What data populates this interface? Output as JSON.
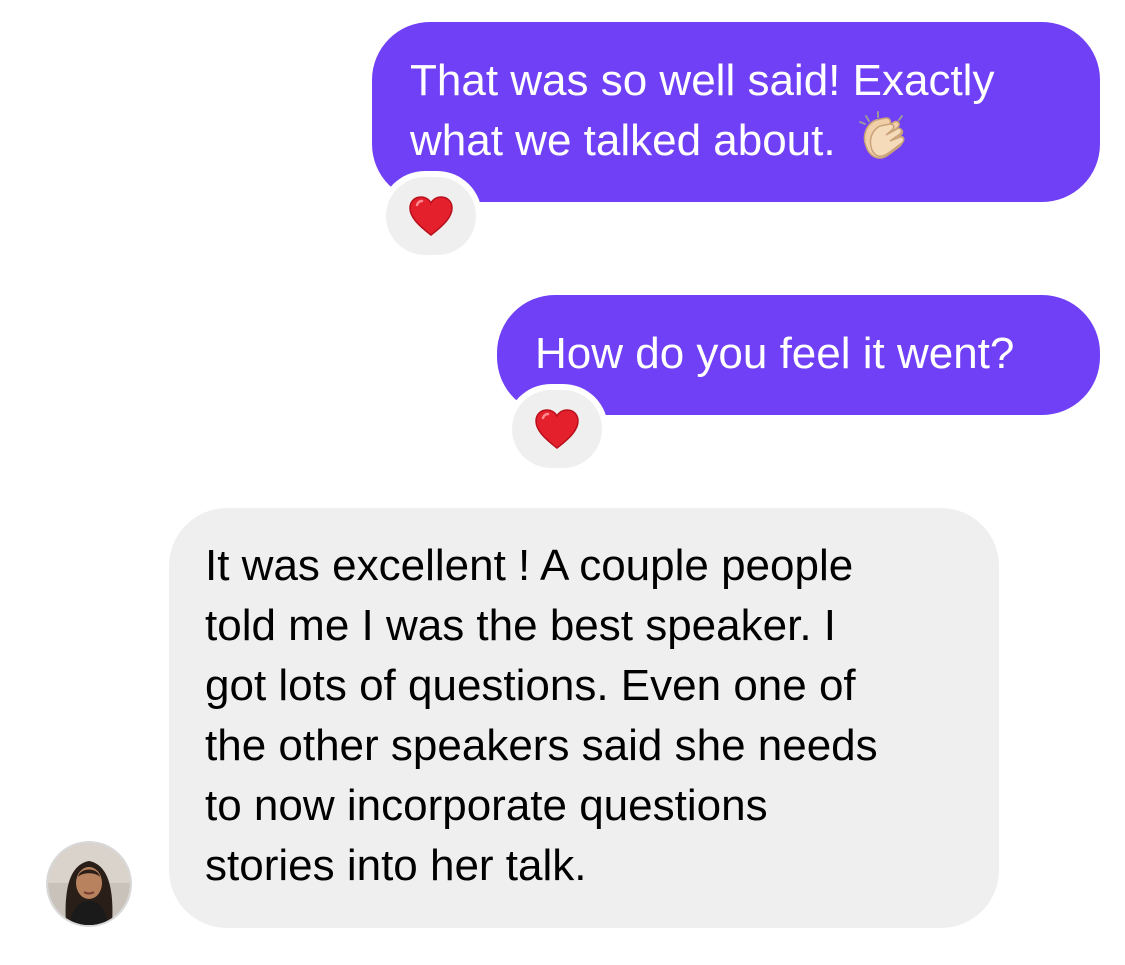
{
  "thread": {
    "messages": [
      {
        "direction": "sent",
        "lines": [
          "That was so well said! Exactly",
          "what we talked about."
        ],
        "emoji": "clapping-hands-icon",
        "reaction": "heart-icon"
      },
      {
        "direction": "sent",
        "lines": [
          "How do you feel it went?"
        ],
        "reaction": "heart-icon"
      },
      {
        "direction": "received",
        "lines": [
          "It was excellent ! A couple people",
          "told me I was the best speaker. I",
          "got lots of questions. Even one of",
          "the other speakers said she needs",
          "to now incorporate questions",
          "stories into her talk."
        ]
      }
    ]
  },
  "colors": {
    "sent_bubble": "#7040f7",
    "received_bubble": "#efefef",
    "heart": "#e5202d"
  }
}
